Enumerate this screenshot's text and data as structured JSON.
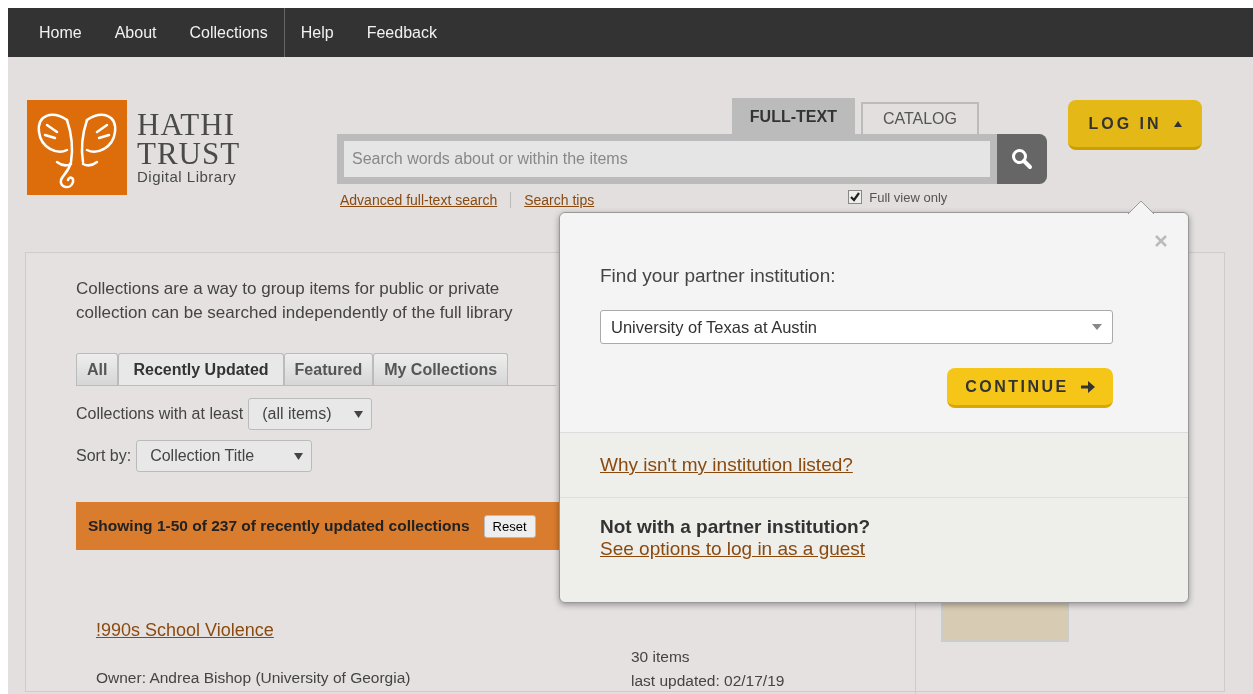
{
  "nav": [
    {
      "label": "Home"
    },
    {
      "label": "About"
    },
    {
      "label": "Collections"
    },
    {
      "label": "Help"
    },
    {
      "label": "Feedback"
    }
  ],
  "logo": {
    "line1": "HATHI",
    "line2": "TRUST",
    "line3": "Digital Library"
  },
  "search": {
    "tabs": [
      {
        "label": "FULL-TEXT",
        "selected": true
      },
      {
        "label": "CATALOG",
        "selected": false
      }
    ],
    "placeholder": "Search words about or within the items",
    "links": [
      "Advanced full-text search",
      "Search tips"
    ],
    "full_view": {
      "label": "Full view only",
      "checked": true
    }
  },
  "login": {
    "label": "LOG IN"
  },
  "intro": [
    "Collections are a way to group items for public or private",
    "collection can be searched independently of the full library"
  ],
  "filter_tabs": [
    {
      "label": "All",
      "selected": false
    },
    {
      "label": "Recently Updated",
      "selected": true
    },
    {
      "label": "Featured",
      "selected": false
    },
    {
      "label": "My Collections",
      "selected": false
    }
  ],
  "filters": [
    {
      "label": "Collections with at least",
      "value": "(all items)"
    },
    {
      "label": "Sort by:",
      "value": "Collection Title"
    }
  ],
  "results": {
    "text": "Showing 1-50 of 237 of recently updated collections",
    "reset": "Reset"
  },
  "collection": {
    "title": "!990s School Violence",
    "owner": "Owner: Andrea Bishop (University of Georgia)",
    "count": "30 items",
    "updated": "last updated: 02/17/19"
  },
  "popup": {
    "prompt": "Find your partner institution:",
    "institution": "University of Texas at Austin",
    "continue": "CONTINUE",
    "why_link": "Why isn't my institution listed?",
    "guest_heading": "Not with a partner institution?",
    "guest_link": "See options to log in as a guest"
  }
}
